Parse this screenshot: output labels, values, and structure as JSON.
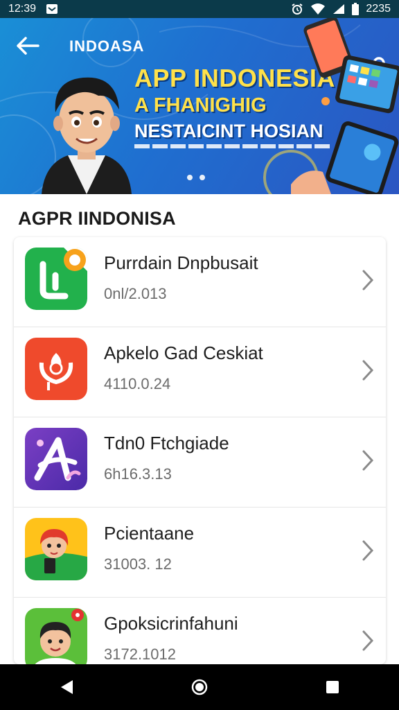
{
  "status_bar": {
    "time": "12:39",
    "right_text": "2235",
    "icons": [
      "notification-icon",
      "alarm-icon",
      "wifi-icon",
      "signal-icon",
      "battery-icon"
    ]
  },
  "banner": {
    "brand": "INDOASA",
    "headline_1": "APP INDONESIA",
    "headline_2": "A FHANIGHIG",
    "headline_3": "NESTAICINT HOSIAN",
    "back_icon": "arrow-left-icon",
    "search_icon": "search-icon",
    "page_count": 2,
    "colors": {
      "accent": "#ffe14a",
      "background": "#1f6fd0"
    }
  },
  "section": {
    "title": "AGPR IINDONISA"
  },
  "apps": [
    {
      "name": "Purrdain Dnpbusait",
      "version": "0nl/2.013",
      "icon": "green-phone-app-icon"
    },
    {
      "name": "Apkelo Gad Ceskiat",
      "version": "4110.0.24",
      "icon": "red-flower-app-icon"
    },
    {
      "name": "Tdn0 Ftchgiade",
      "version": "6h16.3.13",
      "icon": "purple-letter-a-app-icon"
    },
    {
      "name": "Pcientaane",
      "version": "31003. 12",
      "icon": "yellow-character-app-icon"
    },
    {
      "name": "Gpoksicrinfahuni",
      "version": "3172.1012",
      "icon": "green-boy-app-icon"
    }
  ],
  "nav_bar": {
    "icons": [
      "back-triangle-icon",
      "home-circle-icon",
      "recents-square-icon"
    ]
  }
}
